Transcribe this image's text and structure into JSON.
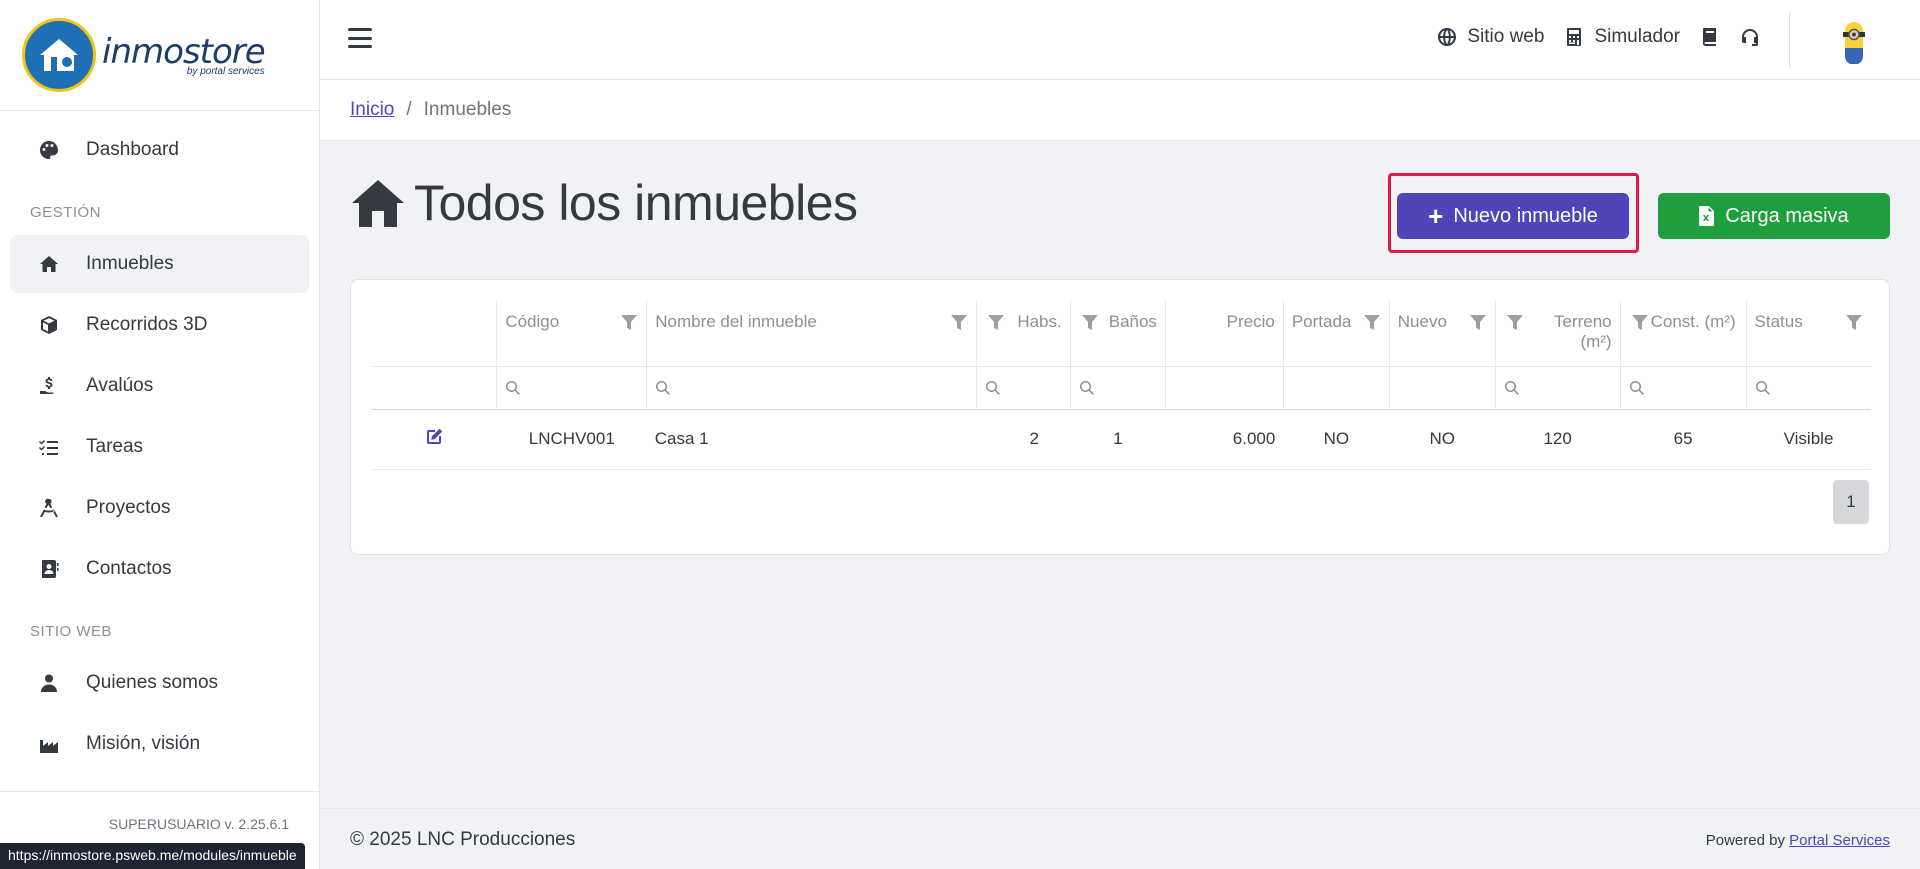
{
  "brand": {
    "name": "inmostore",
    "tagline": "by portal services"
  },
  "sidebar": {
    "items_top": [
      {
        "label": "Dashboard",
        "icon": "palette-icon"
      }
    ],
    "section_gestion": "GESTIÓN",
    "items_gestion": [
      {
        "label": "Inmuebles",
        "icon": "home-icon",
        "active": true
      },
      {
        "label": "Recorridos 3D",
        "icon": "cube-icon"
      },
      {
        "label": "Avalúos",
        "icon": "hand-money-icon"
      },
      {
        "label": "Tareas",
        "icon": "list-check-icon"
      },
      {
        "label": "Proyectos",
        "icon": "compass-drafting-icon"
      },
      {
        "label": "Contactos",
        "icon": "address-book-icon"
      }
    ],
    "section_sitio": "SITIO WEB",
    "items_sitio": [
      {
        "label": "Quienes somos",
        "icon": "user-tie-icon"
      },
      {
        "label": "Misión, visión",
        "icon": "industry-icon"
      }
    ],
    "version": "SUPERUSUARIO v. 2.25.6.1",
    "status_url": "https://inmostore.psweb.me/modules/inmueble"
  },
  "topbar": {
    "sitio_web": "Sitio web",
    "simulador": "Simulador"
  },
  "breadcrumb": {
    "home": "Inicio",
    "separator": "/",
    "current": "Inmuebles"
  },
  "page": {
    "title": "Todos los inmuebles",
    "new_button": "Nuevo inmueble",
    "bulk_button": "Carga masiva"
  },
  "table": {
    "headers": {
      "codigo": "Código",
      "nombre": "Nombre del inmueble",
      "habs": "Habs.",
      "banos": "Baños",
      "precio": "Precio",
      "portada": "Portada",
      "nuevo": "Nuevo",
      "terreno": "Terreno",
      "terreno_unit": "(m²)",
      "const": "Const. (m²)",
      "status": "Status"
    },
    "rows": [
      {
        "codigo": "LNCHV001",
        "nombre": "Casa 1",
        "habs": "2",
        "banos": "1",
        "precio": "6.000",
        "portada": "NO",
        "nuevo": "NO",
        "terreno": "120",
        "const": "65",
        "status": "Visible"
      }
    ],
    "page": "1"
  },
  "footer": {
    "copyright": "© 2025 LNC Producciones",
    "powered_prefix": "Powered by",
    "powered_link": "Portal Services"
  },
  "colors": {
    "primary": "#4e45b8",
    "success": "#1f9e3d",
    "highlight": "#e0184d"
  }
}
